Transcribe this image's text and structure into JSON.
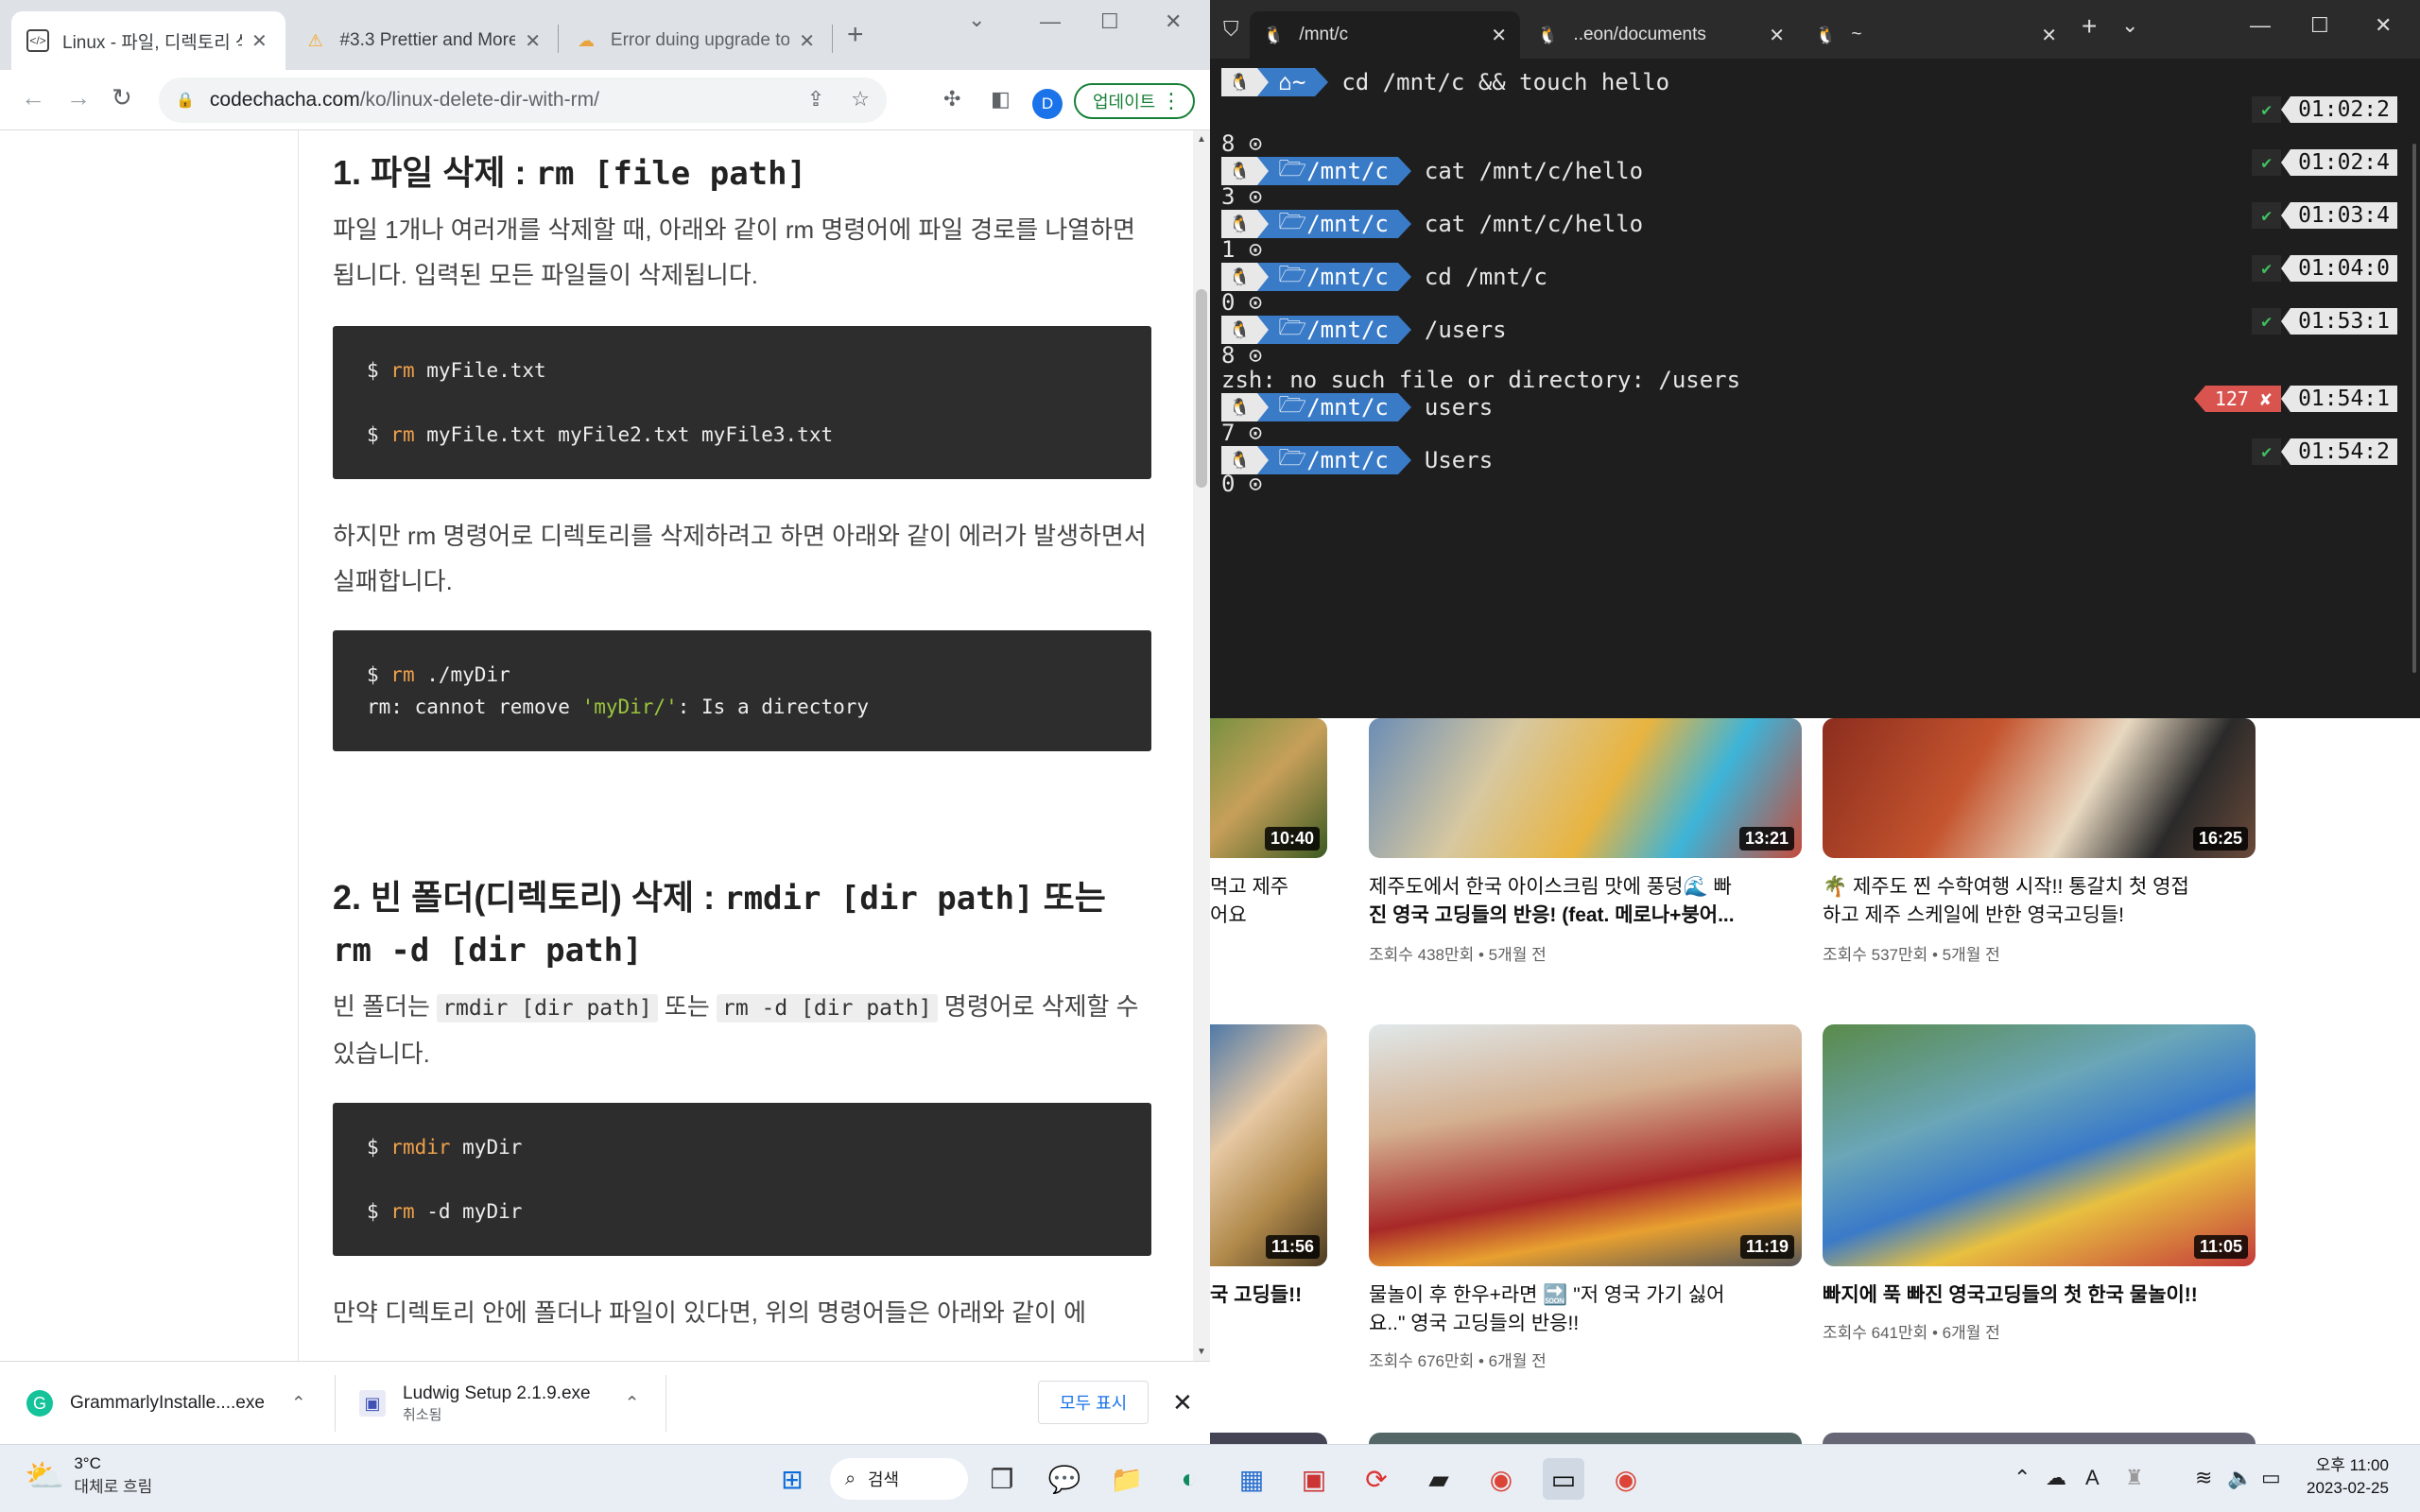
{
  "browser": {
    "tabs": [
      {
        "label": "Linux - 파일, 디렉토리 삭제",
        "icon": "code-icon"
      },
      {
        "label": "#3.3 Prettier and More",
        "icon": "nomad-icon"
      },
      {
        "label": "Error duing upgrade to",
        "icon": "cloud-icon"
      }
    ],
    "url_domain": "codechacha.com",
    "url_path": "/ko/linux-delete-dir-with-rm/",
    "profile_initial": "D",
    "update_label": "업데이트"
  },
  "article": {
    "h1_text": "1. 파일 삭제 : ",
    "h1_code": "rm [file path]",
    "p1": "파일 1개나 여러개를 삭제할 때, 아래와 같이 rm 명령어에 파일 경로를 나열하면 됩니다. 입력된 모든 파일들이 삭제됩니다.",
    "code1": {
      "line1_prompt": "$ ",
      "line1_cmd": "rm",
      "line1_args": " myFile.txt",
      "line2_prompt": "$ ",
      "line2_cmd": "rm",
      "line2_args": " myFile.txt myFile2.txt myFile3.txt"
    },
    "p2": "하지만 rm 명령어로 디렉토리를 삭제하려고 하면 아래와 같이 에러가 발생하면서 실패합니다.",
    "code2": {
      "line1_prompt": "$ ",
      "line1_cmd": "rm",
      "line1_args": " ./myDir",
      "line2_a": "rm: cannot remove ",
      "line2_str": "'myDir/'",
      "line2_b": ": Is a directory"
    },
    "h2_text": "2. 빈 폴더(디렉토리) 삭제 : ",
    "h2_code1": "rmdir [dir path]",
    "h2_mid": " 또는 ",
    "h2_code2": "rm -d [dir path]",
    "p3_a": "빈 폴더는 ",
    "p3_code1": "rmdir [dir path]",
    "p3_b": " 또는 ",
    "p3_code2": "rm -d [dir path]",
    "p3_c": " 명령어로 삭제할 수 있습니다.",
    "code3": {
      "line1_prompt": "$ ",
      "line1_cmd": "rmdir",
      "line1_args": " myDir",
      "line2_prompt": "$ ",
      "line2_cmd": "rm",
      "line2_args": " -d myDir"
    },
    "p4": "만약 디렉토리 안에 폴더나 파일이 있다면, 위의 명령어들은 아래와 같이 에"
  },
  "downloads": {
    "items": [
      {
        "name": "GrammarlyInstalle....exe",
        "status": ""
      },
      {
        "name": "Ludwig Setup 2.1.9.exe",
        "status": "취소됨"
      }
    ],
    "show_all": "모두 표시"
  },
  "terminal": {
    "tabs": [
      {
        "label": "/mnt/c"
      },
      {
        "label": "..eon/documents"
      },
      {
        "label": "~"
      }
    ],
    "first_cmd": {
      "dir": "~",
      "cmd": "cd /mnt/c && touch hello",
      "time": "01:02:2"
    },
    "entries": [
      {
        "count": "8",
        "dir": "/mnt/c",
        "cmd": "cat /mnt/c/hello",
        "status": "✔",
        "time": "01:02:4"
      },
      {
        "count": "3",
        "dir": "/mnt/c",
        "cmd": "cat /mnt/c/hello",
        "status": "✔",
        "time": "01:03:4"
      },
      {
        "count": "1",
        "dir": "/mnt/c",
        "cmd": "cd /mnt/c",
        "status": "✔",
        "time": "01:04:0"
      },
      {
        "count": "0",
        "dir": "/mnt/c",
        "cmd": "/users",
        "status": "✔",
        "time": "01:53:1"
      },
      {
        "count": "8",
        "dir": "/mnt/c",
        "cmd": "users",
        "status": "127 ✘",
        "time": "01:54:1"
      },
      {
        "count": "7",
        "dir": "/mnt/c",
        "cmd": "Users",
        "status": "✔",
        "time": "01:54:2"
      }
    ],
    "error_line": "zsh: no such file or directory: /users",
    "last_count": "0"
  },
  "youtube": {
    "row1": [
      {
        "duration": "10:40",
        "title_line1": "먹고 제주",
        "title_line2": "어요",
        "meta": ""
      },
      {
        "duration": "13:21",
        "title_line1": "제주도에서 한국 아이스크림 맛에 풍덩🌊 빠",
        "title_line2": "진 영국 고딩들의 반응! (feat. 메로나+붕어...",
        "meta": "조회수 438만회 • 5개월 전"
      },
      {
        "duration": "16:25",
        "title_line1": "🌴 제주도 찐 수학여행 시작!! 통갈치 첫 영접",
        "title_line2": "하고 제주 스케일에 반한 영국고딩들!",
        "meta": "조회수 537만회 • 5개월 전"
      }
    ],
    "row2": [
      {
        "duration": "11:56",
        "title_line1": "국 고딩들!!",
        "title_line2": "",
        "meta": ""
      },
      {
        "duration": "11:19",
        "title_line1": "물놀이 후 한우+라면 🔜 \"저 영국 가기 싫어",
        "title_line2": "요..\" 영국 고딩들의 반응!!",
        "meta": "조회수 676만회 • 6개월 전"
      },
      {
        "duration": "11:05",
        "title_line1": "빠지에 푹 빠진 영국고딩들의 첫 한국 물놀이!!",
        "title_line2": "",
        "meta": "조회수 641만회 • 6개월 전"
      }
    ]
  },
  "taskbar": {
    "weather_temp": "3°C",
    "weather_cond": "대체로 흐림",
    "search_label": "검색",
    "clock_time": "오후 11:00",
    "clock_date": "2023-02-25"
  }
}
